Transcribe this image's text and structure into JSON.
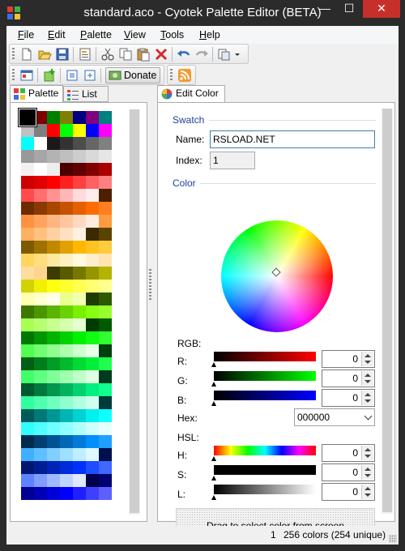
{
  "window": {
    "title": "standard.aco - Cyotek Palette Editor (BETA)",
    "min_glyph": "—",
    "max_glyph": "☐",
    "close_glyph": "✕"
  },
  "menu": [
    {
      "label": "File",
      "accel": "F",
      "rest": "ile"
    },
    {
      "label": "Edit",
      "accel": "E",
      "rest": "dit"
    },
    {
      "label": "Palette",
      "accel": "P",
      "rest": "alette"
    },
    {
      "label": "View",
      "accel": "V",
      "rest": "iew"
    },
    {
      "label": "Tools",
      "accel": "T",
      "rest": "ools"
    },
    {
      "label": "Help",
      "accel": "H",
      "rest": "elp"
    }
  ],
  "toolbar": {
    "donate_label": "Donate"
  },
  "left_tabs": {
    "palette": "Palette",
    "list": "List"
  },
  "right_tabs": {
    "edit_color": "Edit Color"
  },
  "swatch_group": {
    "title": "Swatch",
    "name_label": "Name:",
    "name_value": "RSLOAD.NET",
    "index_label": "Index:",
    "index_value": "1"
  },
  "color_group": {
    "title": "Color",
    "rgb_label": "RGB:",
    "r_label": "R:",
    "r_value": "0",
    "g_label": "G:",
    "g_value": "0",
    "b_label": "B:",
    "b_value": "0",
    "hex_label": "Hex:",
    "hex_value": "000000",
    "hsl_label": "HSL:",
    "h_label": "H:",
    "h_value": "0",
    "s_label": "S:",
    "s_value": "0",
    "l_label": "L:",
    "l_value": "0",
    "dropper_text": "Drag to select color from screen"
  },
  "status": {
    "selected_index": "1",
    "color_count": "256 colors (254 unique)"
  },
  "palette_colors": [
    "#000000",
    "#800000",
    "#008000",
    "#808000",
    "#000080",
    "#800080",
    "#008080",
    "#c0c0c0",
    "#808080",
    "#ff0000",
    "#00ff00",
    "#ffff00",
    "#0000ff",
    "#ff00ff",
    "#00ffff",
    "#ffffff",
    "#1a1a1a",
    "#333333",
    "#4d4d4d",
    "#666666",
    "#808080",
    "#999999",
    "#a6a6a6",
    "#b3b3b3",
    "#bfbfbf",
    "#cccccc",
    "#d9d9d9",
    "#e6e6e6",
    "#f2f2f2",
    "#ffffff",
    "#eeeeee",
    "#4a0000",
    "#600000",
    "#800000",
    "#aa0000",
    "#cc0000",
    "#e00000",
    "#ff0000",
    "#ff2020",
    "#ff4040",
    "#ff6060",
    "#ff8080",
    "#ff4b4b",
    "#ff6f6f",
    "#ff9393",
    "#ffb7b7",
    "#ffdbdb",
    "#ffeded",
    "#4d1f00",
    "#6b2c00",
    "#8a3900",
    "#a84600",
    "#c75300",
    "#e56000",
    "#ff6d00",
    "#ff7f1f",
    "#ff913f",
    "#ffa35f",
    "#ffb57f",
    "#ffc79f",
    "#ffd9bf",
    "#ffebdf",
    "#ff9a40",
    "#ffb060",
    "#ffc080",
    "#ffd0a0",
    "#ffe0c0",
    "#fff0e0",
    "#3b2a00",
    "#5c4200",
    "#7d5a00",
    "#9e7100",
    "#bf8900",
    "#e0a100",
    "#ffb800",
    "#ffc21f",
    "#ffcb3f",
    "#ffd55f",
    "#ffde7f",
    "#ffe89f",
    "#fff1bf",
    "#fffadf",
    "#ffeecc",
    "#ffe4b0",
    "#ffdca0",
    "#ffd490",
    "#3b3b00",
    "#5a5a00",
    "#787800",
    "#969600",
    "#b4b400",
    "#d2d200",
    "#f0f000",
    "#ffff10",
    "#ffff30",
    "#ffff50",
    "#ffff70",
    "#ffff90",
    "#ffffb0",
    "#ffffd0",
    "#ffffe8",
    "#eaff90",
    "#f0ffb0",
    "#1e3b00",
    "#2d5a00",
    "#3c7800",
    "#4b9600",
    "#5ab400",
    "#69d200",
    "#78f000",
    "#87ff10",
    "#97ff30",
    "#a7ff50",
    "#b7ff70",
    "#c7ff90",
    "#d7ffb0",
    "#e7ffd0",
    "#003b00",
    "#005a00",
    "#007800",
    "#009600",
    "#00b400",
    "#00d200",
    "#00f000",
    "#10ff10",
    "#30ff30",
    "#50ff50",
    "#70ff70",
    "#90ff90",
    "#b0ffb0",
    "#d0ffd0",
    "#e8ffe8",
    "#00400f",
    "#005e16",
    "#007d1d",
    "#009c24",
    "#00bb2b",
    "#00da32",
    "#00f039",
    "#20ff50",
    "#40ff68",
    "#60ff80",
    "#80ff98",
    "#a0ffb0",
    "#c0ffc8",
    "#e0ffe0",
    "#003b1f",
    "#005a2f",
    "#00783f",
    "#00964f",
    "#00b45f",
    "#00d26f",
    "#00f07f",
    "#10ff8f",
    "#30ff9f",
    "#50ffaf",
    "#70ffbf",
    "#90ffcf",
    "#b0ffdf",
    "#d0ffef",
    "#003b3b",
    "#005a5a",
    "#007878",
    "#009696",
    "#00b4b4",
    "#00d2d2",
    "#00f0f0",
    "#10ffff",
    "#30ffff",
    "#50ffff",
    "#70ffff",
    "#90ffff",
    "#b0ffff",
    "#d0ffff",
    "#e8ffff",
    "#002b4d",
    "#003f70",
    "#005393",
    "#0067b6",
    "#007bd9",
    "#008ffc",
    "#1f9fff",
    "#3fafff",
    "#5fbfff",
    "#7fcfff",
    "#9fdfff",
    "#bfefff",
    "#dff7ff",
    "#000f4d",
    "#001670",
    "#001d93",
    "#0024b6",
    "#002bd9",
    "#0032fc",
    "#1f4dff",
    "#3f68ff",
    "#5f83ff",
    "#7f9eff",
    "#9fb9ff",
    "#bfd4ff",
    "#dfe9ff",
    "#00004d",
    "#000070",
    "#000093",
    "#0000b6",
    "#0000d9",
    "#0000fc",
    "#1f1fff",
    "#3f3fff",
    "#5f5fff",
    "#7f7fff",
    "#9f9fff",
    "#bfbfff",
    "#dfdfff",
    "#1a0070",
    "#1e0093",
    "#2200b6",
    "#2600d9",
    "#2a00fc",
    "#4a1fff",
    "#6a3fff",
    "#8a5fff",
    "#aa7fff",
    "#ca9fff",
    "#eabfff",
    "#f2dfff"
  ]
}
